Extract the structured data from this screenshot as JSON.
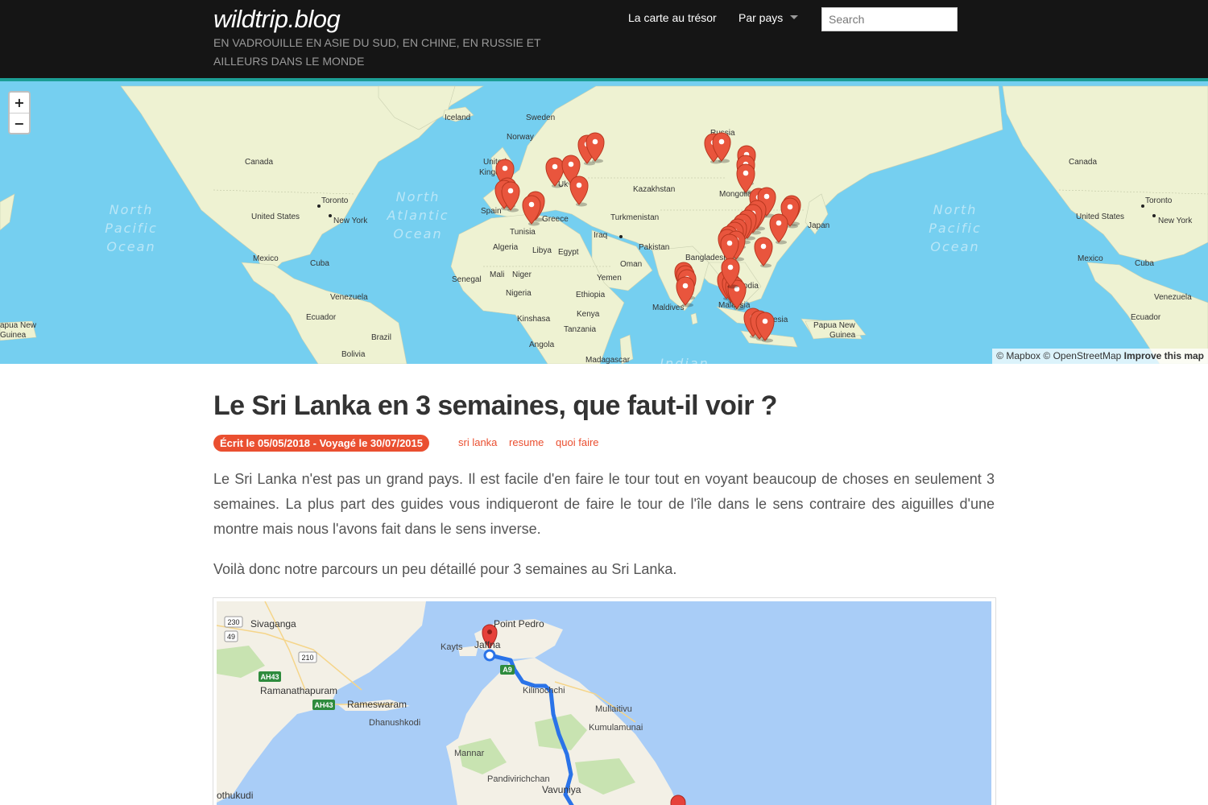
{
  "header": {
    "site_title": "wildtrip.blog",
    "tagline": "EN VADROUILLE EN ASIE DU SUD, EN CHINE, EN RUSSIE ET AILLEURS DANS LE MONDE",
    "nav": {
      "treasure_map": "La carte au trésor",
      "by_country": "Par pays"
    },
    "search_placeholder": "Search"
  },
  "world_map": {
    "zoom_in": "+",
    "zoom_out": "−",
    "attribution": {
      "mapbox": "© Mapbox",
      "osm": "© OpenStreetMap",
      "improve": "Improve this map"
    },
    "labels": {
      "iceland": "Iceland",
      "sweden": "Sweden",
      "norway": "Norway",
      "russia": "Russia",
      "canada_left": "Canada",
      "canada_right": "Canada",
      "united_kingdom_1": "United",
      "united_kingdom_2": "Kingdom",
      "ukraine": "Uk",
      "kazakhstan": "Kazakhstan",
      "mongolia": "Mongolia",
      "toronto_left": "Toronto",
      "toronto_right": "Toronto",
      "united_states_left": "United States",
      "united_states_right": "United States",
      "new_york_left": "New York",
      "new_york_right": "New York",
      "spain": "Spain",
      "greece": "Greece",
      "turkmenistan": "Turkmenistan",
      "tunisia": "Tunisia",
      "iraq": "Iraq",
      "japan": "Japan",
      "algeria": "Algeria",
      "libya": "Libya",
      "egypt": "Egypt",
      "pakistan": "Pakistan",
      "mexico_left": "Mexico",
      "mexico_right": "Mexico",
      "cuba_left": "Cuba",
      "cuba_right": "Cuba",
      "oman": "Oman",
      "bangladesh": "Bangladesh",
      "senegal": "Senegal",
      "mali": "Mali",
      "niger": "Niger",
      "yemen": "Yemen",
      "nigeria": "Nigeria",
      "ethiopia": "Ethiopia",
      "venezuela_left": "Venezuela",
      "venezuela_right": "Venezuela",
      "cambodia": "odia",
      "maldives": "Maldives",
      "malaysia": "Malaysia",
      "kenya": "Kenya",
      "ecuador_left": "Ecuador",
      "ecuador_right": "Ecuador",
      "kinshasa": "Kinshasa",
      "papua_new_guinea_1_left": "apua New",
      "papua_new_guinea_2_left": "Guinea",
      "papua_new_guinea_1_right": "Papua New",
      "papua_new_guinea_2_right": "Guinea",
      "indonesia": "esia",
      "brazil": "Brazil",
      "tanzania": "Tanzania",
      "angola": "Angola",
      "bolivia": "Bolivia",
      "madagascar": "Madagascar",
      "ocean_pacific_1": "North",
      "ocean_pacific_2": "Pacific",
      "ocean_pacific_3": "Ocean",
      "ocean_atlantic_1": "North",
      "ocean_atlantic_2": "Atlantic",
      "ocean_atlantic_3": "Ocean",
      "ocean_indian": "Indian"
    }
  },
  "article": {
    "title": "Le Sri Lanka en 3 semaines, que faut-il voir ?",
    "date_badge": "Écrit le 05/05/2018 - Voyagé le 30/07/2015",
    "tags": [
      "sri lanka",
      "resume",
      "quoi faire"
    ],
    "paragraph_1": "Le Sri Lanka n'est pas un grand pays. Il est facile d'en faire le tour tout en voyant beaucoup de choses en seulement 3 semaines. La plus part des guides vous indiqueront de faire le tour de l'île dans le sens contraire des aiguilles d'une montre mais nous l'avons fait dans le sens inverse.",
    "paragraph_2": "Voilà donc notre parcours un peu détaillé pour 3 semaines au Sri Lanka."
  },
  "route_map": {
    "labels": {
      "sivaganga": "Sivaganga",
      "point_pedro": "Point Pedro",
      "kayts": "Kayts",
      "jaffna": "Jaffna",
      "ramanathapuram": "Ramanathapuram",
      "rameswaram": "Rameswaram",
      "kilinochchi": "Kilinochchi",
      "dhanushkodi": "Dhanushkodi",
      "mullaitivu": "Mullaitivu",
      "kumulamunai": "Kumulamunai",
      "mannar": "Mannar",
      "pandivirichchan": "Pandivirichchan",
      "vavuniya": "Vavuniya",
      "thoothukudi": "othukudi"
    },
    "road_shields": {
      "r230": "230",
      "r49": "49",
      "r210": "210",
      "ah43_a": "AH43",
      "ah43_b": "AH43",
      "a9": "A9"
    }
  },
  "colors": {
    "header_bg": "#151515",
    "accent_teal": "#1c9e95",
    "accent_orange": "#ea4f30",
    "ocean": "#75cff0",
    "land": "#eef2d2",
    "route_blue": "#2a73e8",
    "marker_red": "#e6413a"
  }
}
